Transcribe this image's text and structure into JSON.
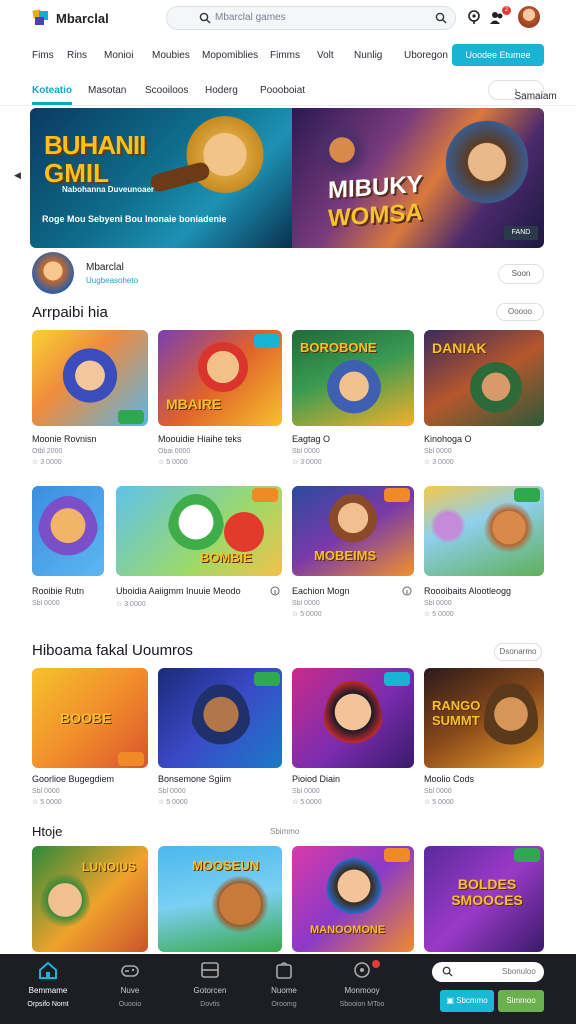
{
  "header": {
    "brand": "Mbarclal",
    "search_placeholder": "Mbarclal games",
    "notif_count": "2"
  },
  "nav": {
    "items": [
      "Fims",
      "Rins",
      "Monioi",
      "Moubies",
      "Mopomiblies",
      "Fimms",
      "Volt",
      "Nunlig",
      "Uboregon"
    ],
    "cta": "Uoodee Etumee"
  },
  "tabs": {
    "items": [
      "Koteatio",
      "Masotan",
      "Scooiloos",
      "Hoderg",
      "Poooboiat"
    ],
    "see_all": "Samaiam"
  },
  "hero": {
    "left_title_1": "BUHANII",
    "left_title_2": "GMIL",
    "left_subtitle": "Nabohanna Duveunoaer",
    "left_caption": "Roge Mou Sebyeni Bou Inonaie boniadenie",
    "right_title_1": "MIBUKY",
    "right_title_2": "WOMSA",
    "right_tag": "FAND"
  },
  "featured": {
    "name": "Mbarclal",
    "sub": "Uugbeasoheto",
    "button": "Soon"
  },
  "sections": [
    {
      "title": "Arrpaibi hia",
      "button": "Ooooo",
      "cards": [
        {
          "name": "Moonie Rovnisn",
          "m1": "Otbl 2000",
          "m2": "☆ 3 0000"
        },
        {
          "name": "Moouidie Hiaihe teks",
          "m1": "Obai 0000",
          "m2": "☆ 5 0000"
        },
        {
          "name": "Eagtag O",
          "m1": "Sbl 0000",
          "m2": "☆ 3 0000",
          "badge": ""
        },
        {
          "name": "Kinohoga O",
          "m1": "Sbl 0000",
          "m2": "☆ 3 0000"
        }
      ]
    },
    {
      "title": "",
      "button": "",
      "cards": [
        {
          "name": "Rooibie Rutn",
          "m1": "Sbl 0000",
          "m2": "☆ 3 0000"
        },
        {
          "name": "Uboidia Aaiigmm Inuuie Meodo",
          "m1": "☆ 3 0000",
          "m2": ""
        },
        {
          "name": "Eachion Mogn",
          "m1": "Sbl 0000",
          "m2": "☆ 5 0000"
        },
        {
          "name": "Roooibaits Alootleogg",
          "m1": "Sbl 0000",
          "m2": "☆ 5 0000"
        }
      ]
    },
    {
      "title": "Hiboama fakal Uoumros",
      "button": "Dsonarmo",
      "cards": [
        {
          "name": "Goorlioe Bugegdiem",
          "m1": "Sbl 0000",
          "m2": "☆ 5 0000"
        },
        {
          "name": "Bonsemone Sgiim",
          "m1": "Sbl 0000",
          "m2": "☆ 5 0000"
        },
        {
          "name": "Pioiod Diain",
          "m1": "Sbl 0000",
          "m2": "☆ 5 0000"
        },
        {
          "name": "Moolio Cods",
          "m1": "Sbl 0000",
          "m2": "☆ 5 0000"
        }
      ]
    },
    {
      "title": "Htoje",
      "button": "Sbimmo",
      "cards": [
        {
          "name": "",
          "m1": "",
          "m2": ""
        },
        {
          "name": "",
          "m1": "",
          "m2": ""
        },
        {
          "name": "",
          "m1": "",
          "m2": ""
        },
        {
          "name": "",
          "m1": "",
          "m2": ""
        }
      ]
    }
  ],
  "card_titles": {
    "c1_2": "MBAIRE",
    "c1_3": "BOROBONE",
    "c1_4": "DANIAK",
    "c2_2": "BOMBIE",
    "c2_3": "MOBEIMS",
    "c3_1": "BOOBE",
    "c3_4": "RANGO SUMMT",
    "c4_1": "LUNOIUS",
    "c4_2": "MOOSEUN",
    "c4_3": "MANOOMONE",
    "c4_4": "BOLDES SMOOCES"
  },
  "dock": {
    "items": [
      {
        "l1": "Bemmame",
        "l2": "Orpsifo Nomt"
      },
      {
        "l1": "Nuve",
        "l2": "Ouooio"
      },
      {
        "l1": "Gotorcen",
        "l2": "Dovtis"
      },
      {
        "l1": "Nuome",
        "l2": "Oroomg"
      },
      {
        "l1": "Monmooy",
        "l2": "Sbooion MToo"
      }
    ],
    "search": "Sbonuloo",
    "btn1": "Sbcmmo",
    "btn2": "Simmoo"
  },
  "colors": {
    "accent": "#19b4d4",
    "green": "#6ab04c",
    "dock": "#1c1e24"
  }
}
